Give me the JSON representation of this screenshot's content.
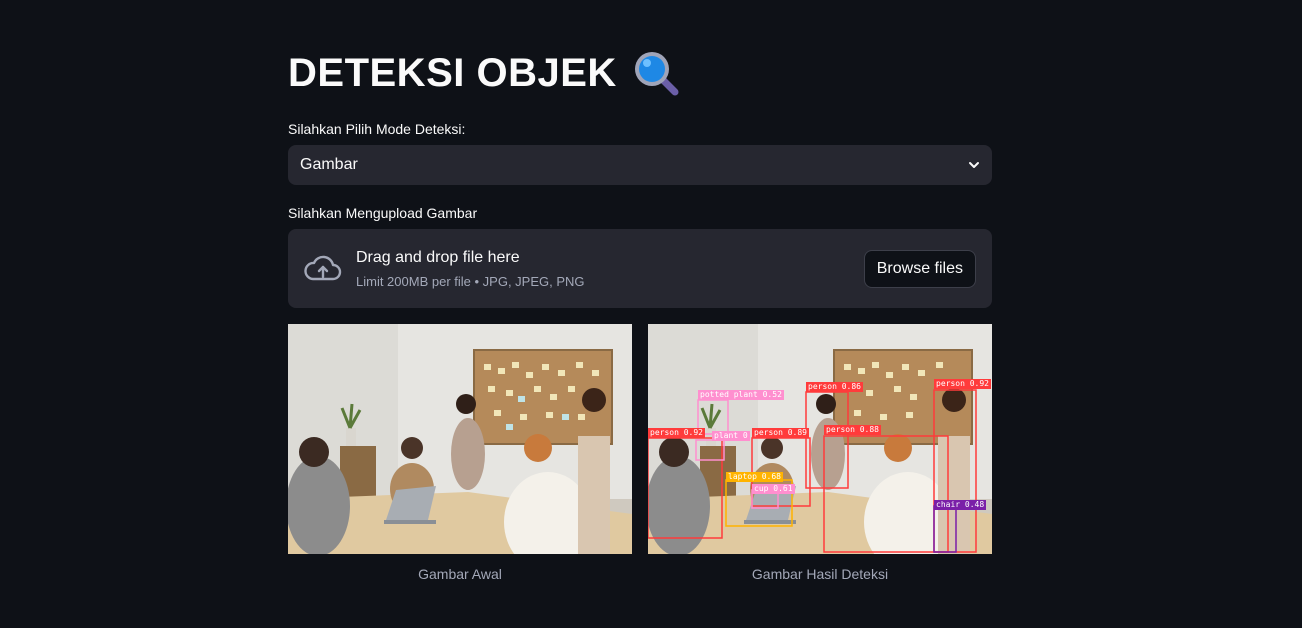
{
  "page": {
    "title": "DETEKSI OBJEK",
    "title_icon": "magnifying-glass-icon"
  },
  "mode": {
    "label": "Silahkan Pilih Mode Deteksi:",
    "selected": "Gambar"
  },
  "upload": {
    "label": "Silahkan Mengupload Gambar",
    "drop_text": "Drag and drop file here",
    "limit_text": "Limit 200MB per file • JPG, JPEG, PNG",
    "browse_label": "Browse files",
    "icon": "cloud-upload-icon"
  },
  "images": {
    "original_caption": "Gambar Awal",
    "result_caption": "Gambar Hasil Deteksi"
  },
  "detections": [
    {
      "label": "potted plant 0.52",
      "color": "#ff8fcf"
    },
    {
      "label": "person 0.86",
      "color": "#ff3b3b"
    },
    {
      "label": "person 0.92",
      "color": "#ff3b3b"
    },
    {
      "label": "person 0.92",
      "color": "#ff3b3b"
    },
    {
      "label": "plant 0",
      "color": "#ff8fcf"
    },
    {
      "label": "person 0.89",
      "color": "#ff3b3b"
    },
    {
      "label": "person 0.88",
      "color": "#ff3b3b"
    },
    {
      "label": "laptop 0.68",
      "color": "#ffb300"
    },
    {
      "label": "cup 0.61",
      "color": "#ff8fcf"
    },
    {
      "label": "chair 0.48",
      "color": "#7a1fa8"
    }
  ],
  "colors": {
    "background": "#0e1117",
    "widget": "#262730",
    "muted_text": "#a3a8b8",
    "person_box": "#ff3b3b",
    "plant_box": "#ff8fcf",
    "laptop_box": "#ffb300",
    "chair_box": "#7a1fa8"
  }
}
